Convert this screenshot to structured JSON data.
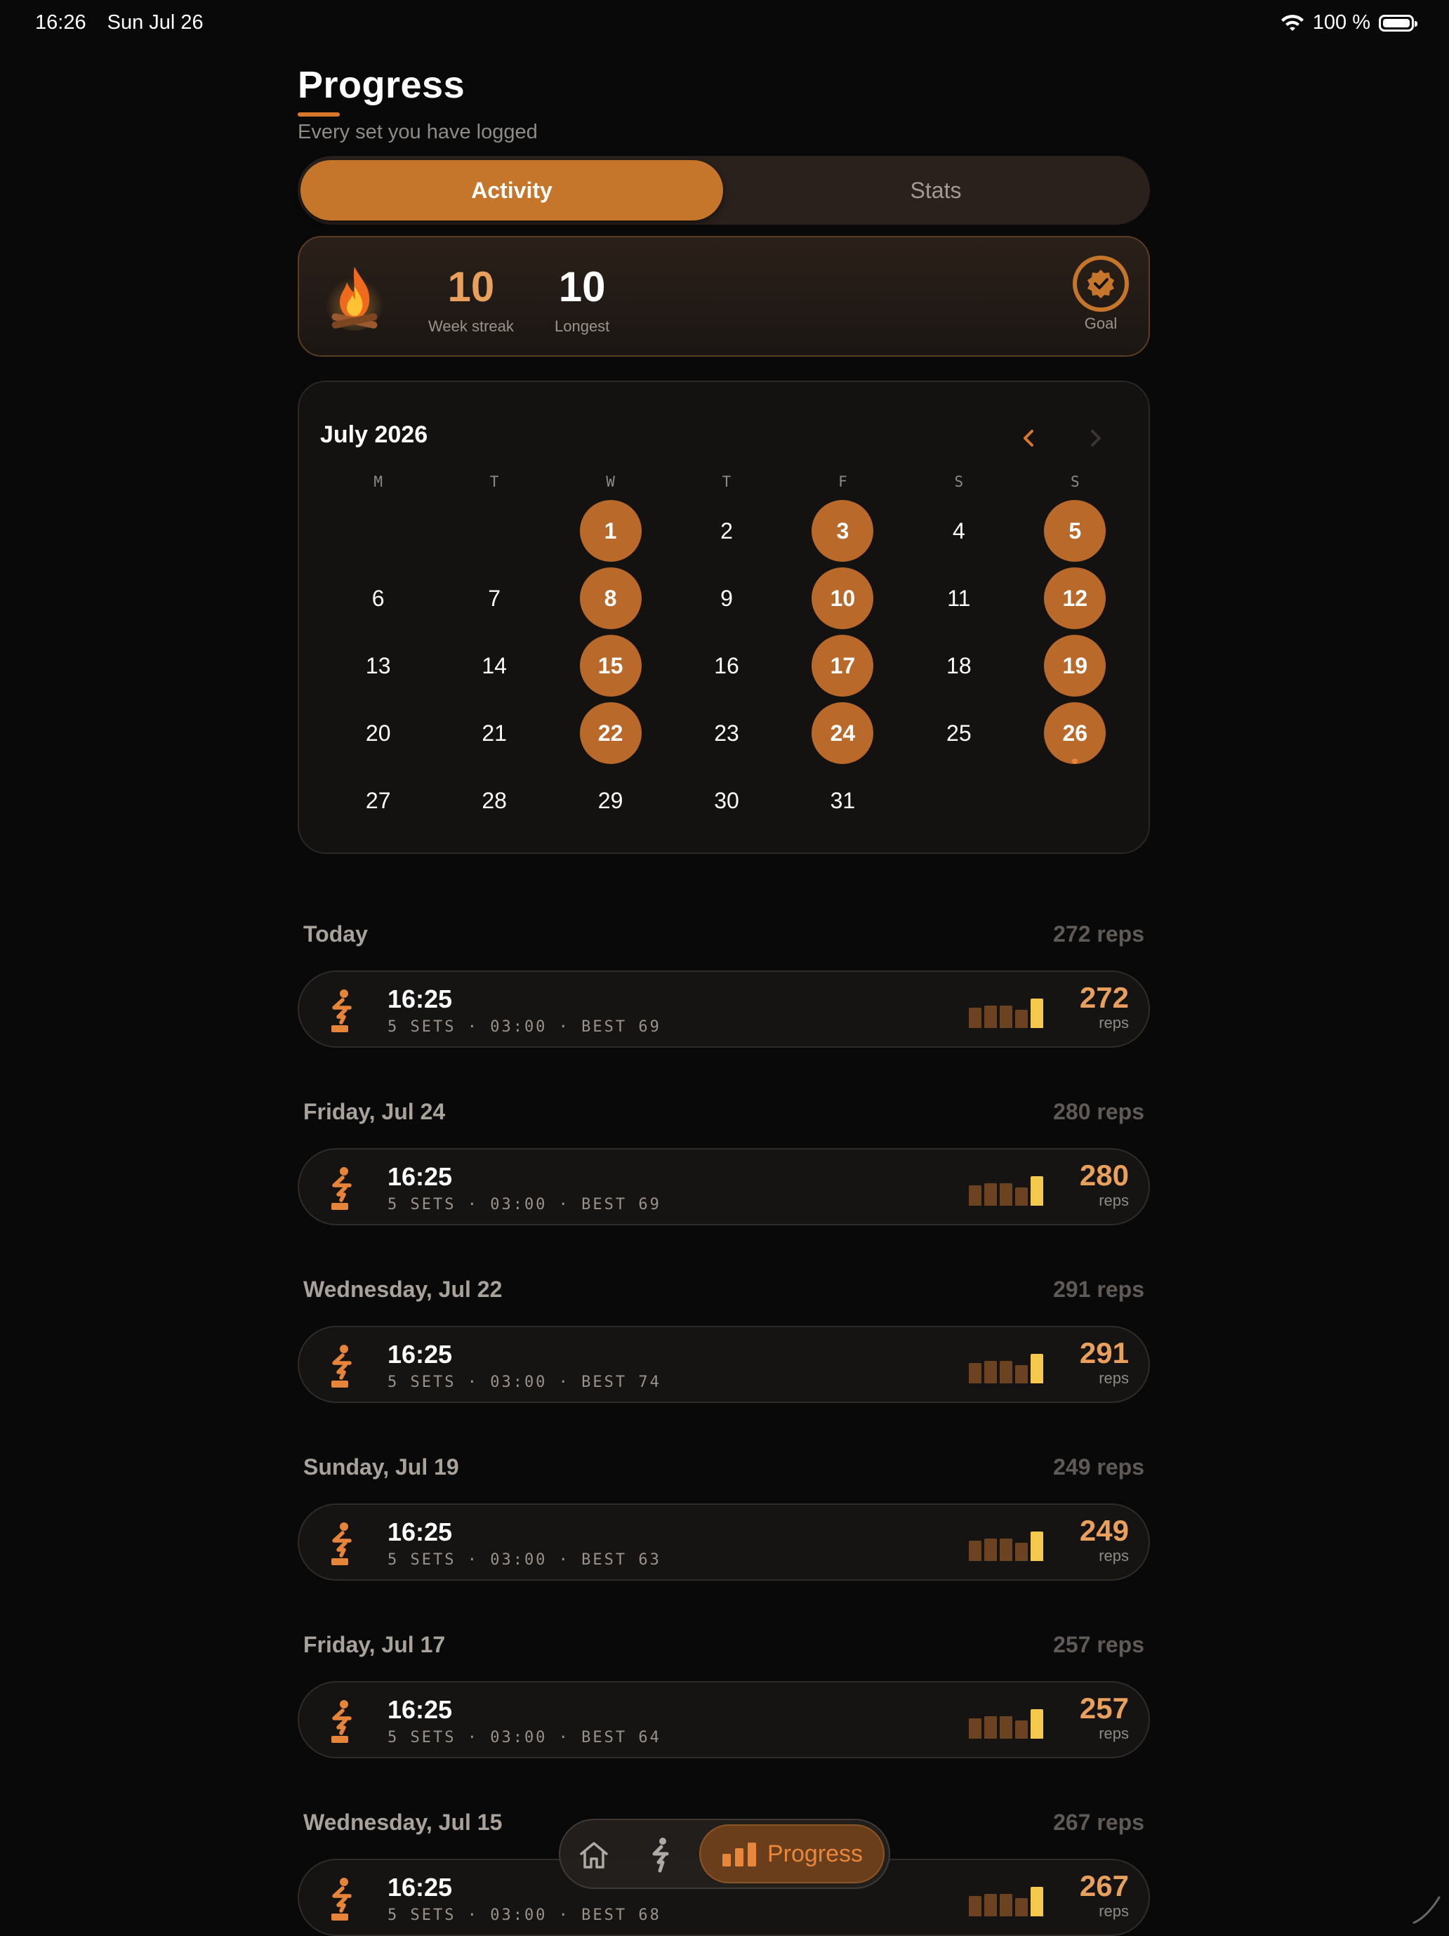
{
  "status_bar": {
    "time": "16:26",
    "date": "Sun Jul 26",
    "battery": "100 %"
  },
  "header": {
    "title": "Progress",
    "subtitle": "Every set you have logged"
  },
  "segment": {
    "active": "Activity",
    "inactive": "Stats"
  },
  "streak": {
    "week_streak": "10",
    "week_streak_label": "Week streak",
    "longest": "10",
    "longest_label": "Longest",
    "goal_label": "Goal"
  },
  "calendar": {
    "month": "July 2026",
    "weekdays": [
      "M",
      "T",
      "W",
      "T",
      "F",
      "S",
      "S"
    ],
    "leading_blanks": 2,
    "days_in_month": 31,
    "active_days": [
      1,
      3,
      5,
      8,
      10,
      12,
      15,
      17,
      19,
      22,
      24,
      26
    ],
    "today": 26
  },
  "sessions": [
    {
      "day": "Today",
      "total": "272 reps",
      "time": "16:25",
      "meta": "5 SETS · 03:00 · BEST 69",
      "reps": "272",
      "unit": "reps",
      "bars": [
        0.55,
        0.62,
        0.62,
        0.5,
        0.8
      ]
    },
    {
      "day": "Friday, Jul 24",
      "total": "280 reps",
      "time": "16:25",
      "meta": "5 SETS · 03:00 · BEST 69",
      "reps": "280",
      "unit": "reps",
      "bars": [
        0.55,
        0.62,
        0.62,
        0.5,
        0.8
      ]
    },
    {
      "day": "Wednesday, Jul 22",
      "total": "291 reps",
      "time": "16:25",
      "meta": "5 SETS · 03:00 · BEST 74",
      "reps": "291",
      "unit": "reps",
      "bars": [
        0.55,
        0.62,
        0.62,
        0.5,
        0.8
      ]
    },
    {
      "day": "Sunday, Jul 19",
      "total": "249 reps",
      "time": "16:25",
      "meta": "5 SETS · 03:00 · BEST 63",
      "reps": "249",
      "unit": "reps",
      "bars": [
        0.55,
        0.62,
        0.62,
        0.5,
        0.8
      ]
    },
    {
      "day": "Friday, Jul 17",
      "total": "257 reps",
      "time": "16:25",
      "meta": "5 SETS · 03:00 · BEST 64",
      "reps": "257",
      "unit": "reps",
      "bars": [
        0.55,
        0.62,
        0.62,
        0.5,
        0.8
      ]
    },
    {
      "day": "Wednesday, Jul 15",
      "total": "267 reps",
      "time": "16:25",
      "meta": "5 SETS · 03:00 · BEST 68",
      "reps": "267",
      "unit": "reps",
      "bars": [
        0.55,
        0.62,
        0.62,
        0.5,
        0.8
      ]
    }
  ],
  "tabbar": {
    "progress_label": "Progress"
  },
  "icons": {
    "wifi": "wifi-icon",
    "battery": "battery-icon",
    "flame": "campfire-icon",
    "goal": "verified-badge-icon",
    "prev": "chevron-left-icon",
    "next": "chevron-right-icon",
    "session": "squat-icon",
    "home": "home-icon",
    "workout": "squat-icon",
    "progress": "bar-chart-icon"
  },
  "colors": {
    "accent": "#c5762b",
    "accent_text": "#e8a05c",
    "bar_highlight": "#f4c94c",
    "background": "#0a0909"
  }
}
